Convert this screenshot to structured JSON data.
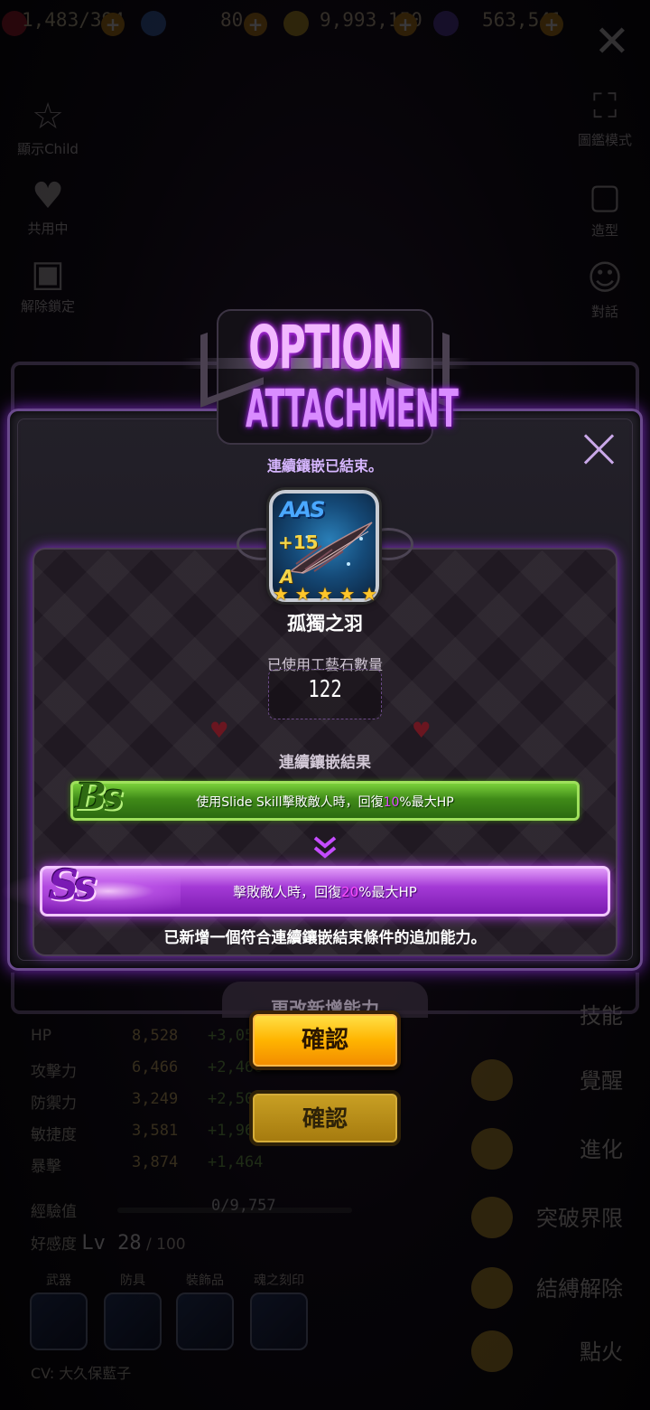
{
  "top_bar": {
    "stamina": "1,483/394",
    "gems": "80",
    "gold": "9,993,150",
    "crystal": "563,541"
  },
  "left_menu": [
    {
      "label": "顯示Child",
      "icon": "star-icon"
    },
    {
      "label": "共用中",
      "icon": "heart-icon"
    },
    {
      "label": "解除鎖定",
      "icon": "lock-icon"
    }
  ],
  "right_menu": [
    {
      "label": "圖鑑模式",
      "icon": "fullscreen-icon"
    },
    {
      "label": "造型",
      "icon": "shirt-icon"
    },
    {
      "label": "對話",
      "icon": "smile-icon"
    }
  ],
  "stats": [
    {
      "label": "HP",
      "value": "8,528",
      "bonus": "+3,051"
    },
    {
      "label": "攻擊力",
      "value": "6,466",
      "bonus": "+2,466"
    },
    {
      "label": "防禦力",
      "value": "3,249",
      "bonus": "+2,505"
    },
    {
      "label": "敏捷度",
      "value": "3,581",
      "bonus": "+1,967"
    },
    {
      "label": "暴擊",
      "value": "3,874",
      "bonus": "+1,464"
    }
  ],
  "exp": {
    "label": "經驗值",
    "value": "0/9,757"
  },
  "favor": {
    "label": "好感度",
    "level": "Lv 28",
    "max": "/ 100"
  },
  "equipment": [
    "武器",
    "防具",
    "裝飾品",
    "魂之刻印"
  ],
  "cv": "CV: 大久保藍子",
  "side_actions": [
    "技能",
    "覺醒",
    "進化",
    "突破界限",
    "結縛解除",
    "點火"
  ],
  "modal": {
    "logo_line1": "OPTION",
    "logo_line2": "ATTACHMENT",
    "finish_message": "連續鑲嵌已結束。",
    "item": {
      "grade": "AAS",
      "enhance": "+15",
      "sub_grade": "A",
      "stars": 5,
      "name": "孤獨之羽"
    },
    "used_label": "已使用工藝石數量",
    "used_count": "122",
    "result_label": "連續鑲嵌結果",
    "old_option": {
      "grade": "Bs",
      "text_before": "使用Slide Skill擊敗敵人時，回復",
      "value": "10",
      "text_after": "%最大HP"
    },
    "new_option": {
      "grade": "Ss",
      "text_before": "擊敗敵人時，回復",
      "value": "20",
      "text_after": "%最大HP"
    },
    "added_message": "已新增一個符合連續鑲嵌結束條件的追加能力。",
    "confirm_label": "確認",
    "confirm_label_2": "確認",
    "background_button": "更改新增能力"
  },
  "colors": {
    "accent_purple": "#a43ad6",
    "option_green": "#3f8a18",
    "confirm_gold": "#ffb400"
  }
}
